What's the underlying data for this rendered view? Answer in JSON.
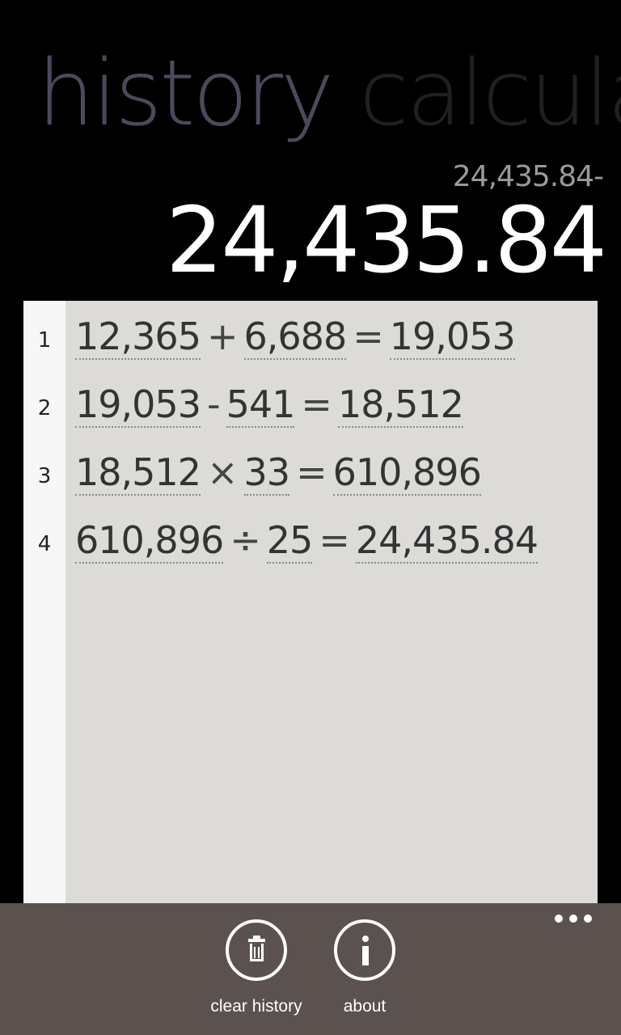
{
  "pivot": {
    "active": "history",
    "next": "calculator"
  },
  "display": {
    "expression": "24,435.84-",
    "result": "24,435.84"
  },
  "history": [
    {
      "index": "1",
      "a": "12,365",
      "op": "+",
      "b": "6,688",
      "eq": "=",
      "result": "19,053"
    },
    {
      "index": "2",
      "a": "19,053",
      "op": "-",
      "b": "541",
      "eq": "=",
      "result": "18,512"
    },
    {
      "index": "3",
      "a": "18,512",
      "op": "×",
      "b": "33",
      "eq": "=",
      "result": "610,896"
    },
    {
      "index": "4",
      "a": "610,896",
      "op": "÷",
      "b": "25",
      "eq": "=",
      "result": "24,435.84"
    }
  ],
  "appbar": {
    "clear_label": "clear history",
    "about_label": "about",
    "clear_icon": "trash-icon",
    "about_icon": "info-icon",
    "background": "#5b514e"
  }
}
